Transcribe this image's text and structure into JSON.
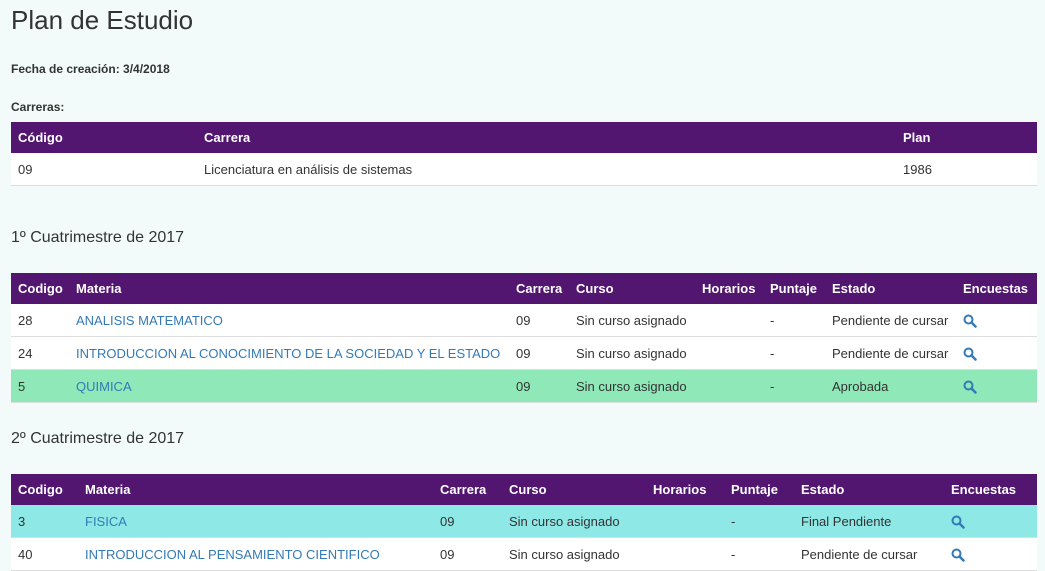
{
  "page": {
    "title": "Plan de Estudio",
    "fecha": "Fecha de creación: 3/4/2018",
    "carreras_label": "Carreras:"
  },
  "carreras": {
    "headers": [
      "Código",
      "Carrera",
      "Plan"
    ],
    "rows": [
      {
        "codigo": "09",
        "carrera": "Licenciatura en análisis de sistemas",
        "plan": "1986"
      }
    ]
  },
  "sem1": {
    "title": "1º Cuatrimestre de 2017",
    "headers": [
      "Codigo",
      "Materia",
      "Carrera",
      "Curso",
      "Horarios",
      "Puntaje",
      "Estado",
      "Encuestas"
    ],
    "rows": [
      {
        "codigo": "28",
        "materia": "ANALISIS MATEMATICO",
        "carrera": "09",
        "curso": "Sin curso asignado",
        "horarios": "",
        "puntaje": "-",
        "estado": "Pendiente de cursar",
        "encuesta_icon": "search-icon",
        "highlight": "none"
      },
      {
        "codigo": "24",
        "materia": "INTRODUCCION AL CONOCIMIENTO DE LA SOCIEDAD Y EL ESTADO",
        "carrera": "09",
        "curso": "Sin curso asignado",
        "horarios": "",
        "puntaje": "-",
        "estado": "Pendiente de cursar",
        "encuesta_icon": "search-icon",
        "highlight": "none"
      },
      {
        "codigo": "5",
        "materia": "QUIMICA",
        "carrera": "09",
        "curso": "Sin curso asignado",
        "horarios": "",
        "puntaje": "-",
        "estado": "Aprobada",
        "encuesta_icon": "search-icon",
        "highlight": "green"
      }
    ]
  },
  "sem2": {
    "title": "2º Cuatrimestre de 2017",
    "headers": [
      "Codigo",
      "Materia",
      "Carrera",
      "Curso",
      "Horarios",
      "Puntaje",
      "Estado",
      "Encuestas"
    ],
    "rows": [
      {
        "codigo": "3",
        "materia": "FISICA",
        "carrera": "09",
        "curso": "Sin curso asignado",
        "horarios": "",
        "puntaje": "-",
        "estado": "Final Pendiente",
        "encuesta_icon": "search-icon",
        "highlight": "cyan"
      },
      {
        "codigo": "40",
        "materia": "INTRODUCCION AL PENSAMIENTO CIENTIFICO",
        "carrera": "09",
        "curso": "Sin curso asignado",
        "horarios": "",
        "puntaje": "-",
        "estado": "Pendiente de cursar",
        "encuesta_icon": "search-icon",
        "highlight": "none"
      }
    ]
  },
  "colors": {
    "header_bg": "#521570",
    "approved_row": "#8fe8b8",
    "pending_final_row": "#8ee9e6",
    "link": "#337ab7",
    "page_bg": "#f2fbf9"
  }
}
